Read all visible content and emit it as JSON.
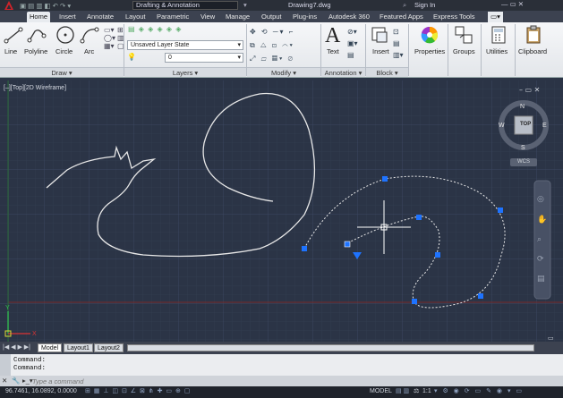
{
  "titlebar": {
    "workspace": "Drafting & Annotation",
    "document": "Drawing7.dwg",
    "sign_in": "Sign In"
  },
  "tabs": [
    "Home",
    "Insert",
    "Annotate",
    "Layout",
    "Parametric",
    "View",
    "Manage",
    "Output",
    "Plug-ins",
    "Autodesk 360",
    "Featured Apps",
    "Express Tools"
  ],
  "draw": {
    "line": "Line",
    "polyline": "Polyline",
    "circle": "Circle",
    "arc": "Arc",
    "title": "Draw"
  },
  "layers": {
    "layer_state": "Unsaved Layer State",
    "current_layer": "0",
    "title": "Layers"
  },
  "modify": {
    "title": "Modify"
  },
  "annotation": {
    "text": "Text",
    "title": "Annotation"
  },
  "block": {
    "insert": "Insert",
    "title": "Block"
  },
  "properties": "Properties",
  "groups": "Groups",
  "utilities": "Utilities",
  "clipboard": "Clipboard",
  "viewport": {
    "label": "[–][Top][2D Wireframe]",
    "viewcube_top": "TOP",
    "north": "N",
    "south": "S",
    "east": "E",
    "west": "W",
    "wcs": "WCS"
  },
  "layout_tabs": [
    "Model",
    "Layout1",
    "Layout2"
  ],
  "command_history": [
    "Command:",
    "Command:"
  ],
  "command_prompt": "Type a command",
  "status": {
    "coordinates": "96.7461, 16.0892, 0.0000",
    "model": "MODEL",
    "scale": "1:1"
  },
  "colors": {
    "canvas": "#2b3446",
    "grip": "#1e73ff",
    "geometry": "#f0f0f0"
  }
}
